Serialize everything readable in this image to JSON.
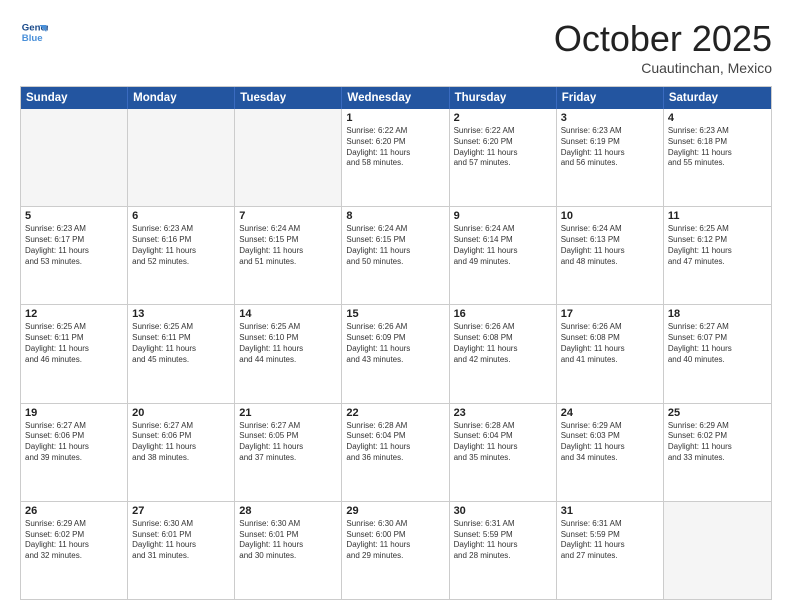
{
  "header": {
    "logo": {
      "line1": "General",
      "line2": "Blue"
    },
    "month": "October 2025",
    "location": "Cuautinchan, Mexico"
  },
  "weekdays": [
    "Sunday",
    "Monday",
    "Tuesday",
    "Wednesday",
    "Thursday",
    "Friday",
    "Saturday"
  ],
  "rows": [
    [
      {
        "num": "",
        "info": "",
        "empty": true
      },
      {
        "num": "",
        "info": "",
        "empty": true
      },
      {
        "num": "",
        "info": "",
        "empty": true
      },
      {
        "num": "1",
        "info": "Sunrise: 6:22 AM\nSunset: 6:20 PM\nDaylight: 11 hours\nand 58 minutes."
      },
      {
        "num": "2",
        "info": "Sunrise: 6:22 AM\nSunset: 6:20 PM\nDaylight: 11 hours\nand 57 minutes."
      },
      {
        "num": "3",
        "info": "Sunrise: 6:23 AM\nSunset: 6:19 PM\nDaylight: 11 hours\nand 56 minutes."
      },
      {
        "num": "4",
        "info": "Sunrise: 6:23 AM\nSunset: 6:18 PM\nDaylight: 11 hours\nand 55 minutes."
      }
    ],
    [
      {
        "num": "5",
        "info": "Sunrise: 6:23 AM\nSunset: 6:17 PM\nDaylight: 11 hours\nand 53 minutes."
      },
      {
        "num": "6",
        "info": "Sunrise: 6:23 AM\nSunset: 6:16 PM\nDaylight: 11 hours\nand 52 minutes."
      },
      {
        "num": "7",
        "info": "Sunrise: 6:24 AM\nSunset: 6:15 PM\nDaylight: 11 hours\nand 51 minutes."
      },
      {
        "num": "8",
        "info": "Sunrise: 6:24 AM\nSunset: 6:15 PM\nDaylight: 11 hours\nand 50 minutes."
      },
      {
        "num": "9",
        "info": "Sunrise: 6:24 AM\nSunset: 6:14 PM\nDaylight: 11 hours\nand 49 minutes."
      },
      {
        "num": "10",
        "info": "Sunrise: 6:24 AM\nSunset: 6:13 PM\nDaylight: 11 hours\nand 48 minutes."
      },
      {
        "num": "11",
        "info": "Sunrise: 6:25 AM\nSunset: 6:12 PM\nDaylight: 11 hours\nand 47 minutes."
      }
    ],
    [
      {
        "num": "12",
        "info": "Sunrise: 6:25 AM\nSunset: 6:11 PM\nDaylight: 11 hours\nand 46 minutes."
      },
      {
        "num": "13",
        "info": "Sunrise: 6:25 AM\nSunset: 6:11 PM\nDaylight: 11 hours\nand 45 minutes."
      },
      {
        "num": "14",
        "info": "Sunrise: 6:25 AM\nSunset: 6:10 PM\nDaylight: 11 hours\nand 44 minutes."
      },
      {
        "num": "15",
        "info": "Sunrise: 6:26 AM\nSunset: 6:09 PM\nDaylight: 11 hours\nand 43 minutes."
      },
      {
        "num": "16",
        "info": "Sunrise: 6:26 AM\nSunset: 6:08 PM\nDaylight: 11 hours\nand 42 minutes."
      },
      {
        "num": "17",
        "info": "Sunrise: 6:26 AM\nSunset: 6:08 PM\nDaylight: 11 hours\nand 41 minutes."
      },
      {
        "num": "18",
        "info": "Sunrise: 6:27 AM\nSunset: 6:07 PM\nDaylight: 11 hours\nand 40 minutes."
      }
    ],
    [
      {
        "num": "19",
        "info": "Sunrise: 6:27 AM\nSunset: 6:06 PM\nDaylight: 11 hours\nand 39 minutes."
      },
      {
        "num": "20",
        "info": "Sunrise: 6:27 AM\nSunset: 6:06 PM\nDaylight: 11 hours\nand 38 minutes."
      },
      {
        "num": "21",
        "info": "Sunrise: 6:27 AM\nSunset: 6:05 PM\nDaylight: 11 hours\nand 37 minutes."
      },
      {
        "num": "22",
        "info": "Sunrise: 6:28 AM\nSunset: 6:04 PM\nDaylight: 11 hours\nand 36 minutes."
      },
      {
        "num": "23",
        "info": "Sunrise: 6:28 AM\nSunset: 6:04 PM\nDaylight: 11 hours\nand 35 minutes."
      },
      {
        "num": "24",
        "info": "Sunrise: 6:29 AM\nSunset: 6:03 PM\nDaylight: 11 hours\nand 34 minutes."
      },
      {
        "num": "25",
        "info": "Sunrise: 6:29 AM\nSunset: 6:02 PM\nDaylight: 11 hours\nand 33 minutes."
      }
    ],
    [
      {
        "num": "26",
        "info": "Sunrise: 6:29 AM\nSunset: 6:02 PM\nDaylight: 11 hours\nand 32 minutes."
      },
      {
        "num": "27",
        "info": "Sunrise: 6:30 AM\nSunset: 6:01 PM\nDaylight: 11 hours\nand 31 minutes."
      },
      {
        "num": "28",
        "info": "Sunrise: 6:30 AM\nSunset: 6:01 PM\nDaylight: 11 hours\nand 30 minutes."
      },
      {
        "num": "29",
        "info": "Sunrise: 6:30 AM\nSunset: 6:00 PM\nDaylight: 11 hours\nand 29 minutes."
      },
      {
        "num": "30",
        "info": "Sunrise: 6:31 AM\nSunset: 5:59 PM\nDaylight: 11 hours\nand 28 minutes."
      },
      {
        "num": "31",
        "info": "Sunrise: 6:31 AM\nSunset: 5:59 PM\nDaylight: 11 hours\nand 27 minutes."
      },
      {
        "num": "",
        "info": "",
        "empty": true
      }
    ]
  ]
}
